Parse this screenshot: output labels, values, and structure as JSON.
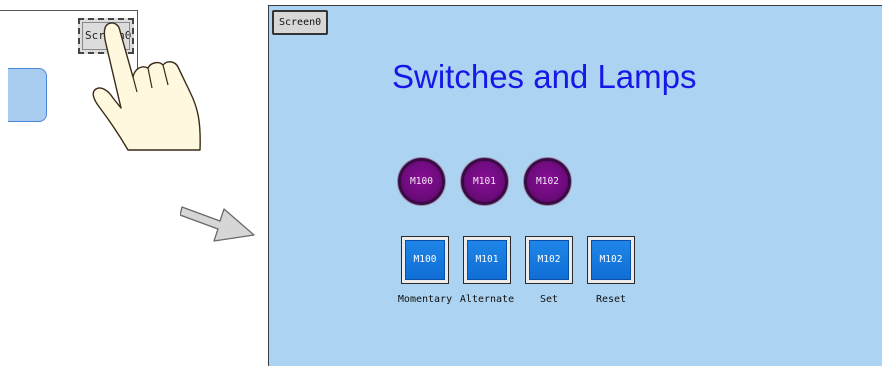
{
  "illustration": {
    "mini_button_label": "Screen0"
  },
  "panel": {
    "screen_tab_label": "Screen0",
    "title": "Switches and Lamps",
    "lamps": [
      "M100",
      "M101",
      "M102"
    ],
    "buttons": [
      {
        "label": "M100",
        "caption": "Momentary"
      },
      {
        "label": "M101",
        "caption": "Alternate"
      },
      {
        "label": "M102",
        "caption": "Set"
      },
      {
        "label": "M102",
        "caption": "Reset"
      }
    ]
  },
  "colors": {
    "panel_background": "#acd3f1",
    "title_text": "#1717e8",
    "lamp_fill": "#6d0b7c",
    "button_fill": "#1478e0"
  },
  "icons": {
    "pointer": "pointing-hand-icon",
    "flow": "right-arrow-icon"
  }
}
